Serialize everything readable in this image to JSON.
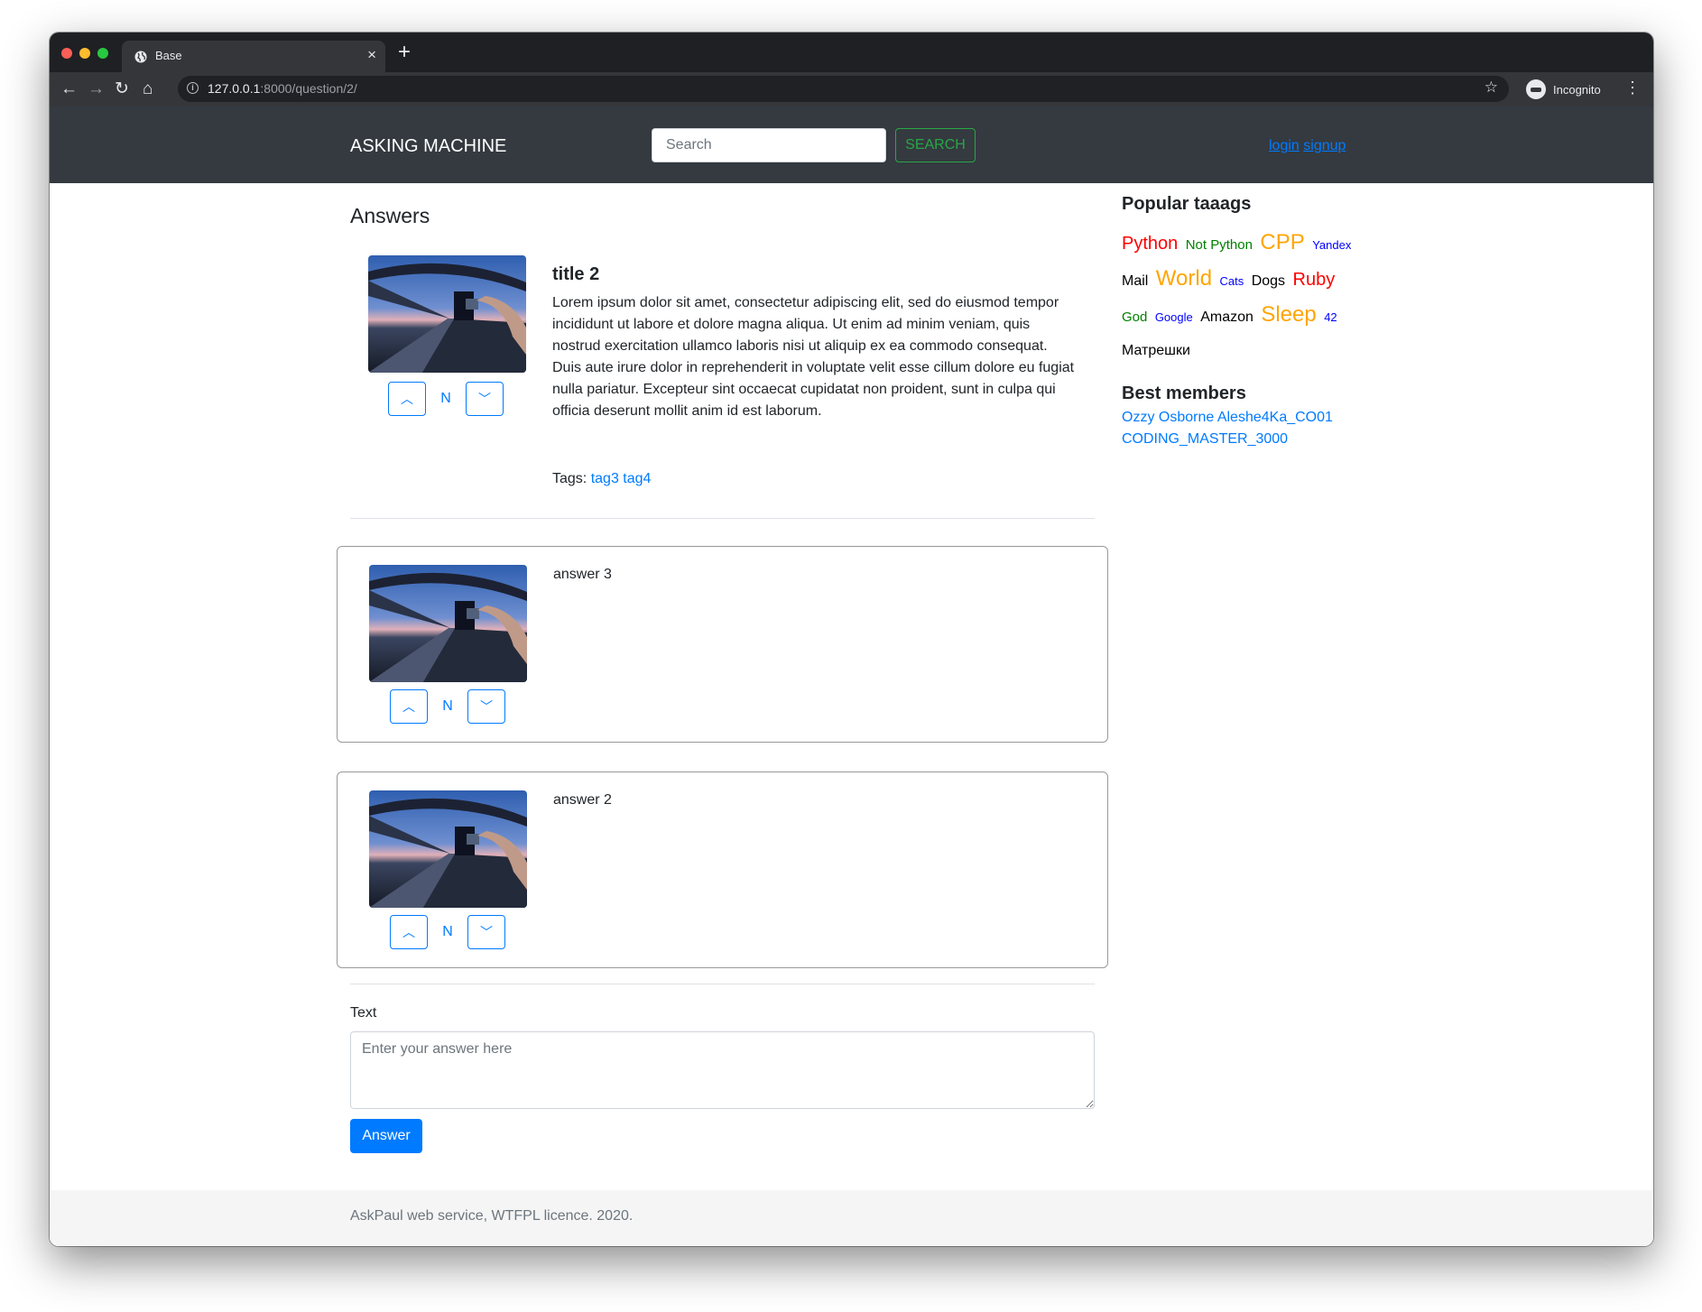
{
  "browser": {
    "tab_title": "Base",
    "url_host": "127.0.0.1",
    "url_path": ":8000/question/2/",
    "profile": "Incognito"
  },
  "navbar": {
    "brand": "ASKING MACHINE",
    "search_placeholder": "Search",
    "search_button": "SEARCH",
    "login": "login",
    "signup": "signup"
  },
  "main": {
    "heading": "Answers",
    "question": {
      "title": "title 2",
      "body": "Lorem ipsum dolor sit amet, consectetur adipiscing elit, sed do eiusmod tempor incididunt ut labore et dolore magna aliqua. Ut enim ad minim veniam, quis nostrud exercitation ullamco laboris nisi ut aliquip ex ea commodo consequat. Duis aute irure dolor in reprehenderit in voluptate velit esse cillum dolore eu fugiat nulla pariatur. Excepteur sint occaecat cupidatat non proident, sunt in culpa qui officia deserunt mollit anim id est laborum.",
      "tags_label": "Tags:",
      "tags": [
        "tag3",
        "tag4"
      ],
      "vote_up": "︿",
      "vote_count": "N",
      "vote_down": "﹀"
    },
    "answers": [
      {
        "text": "answer 3",
        "vote_up": "︿",
        "vote_count": "N",
        "vote_down": "﹀"
      },
      {
        "text": "answer 2",
        "vote_up": "︿",
        "vote_count": "N",
        "vote_down": "﹀"
      }
    ],
    "form": {
      "label": "Text",
      "placeholder": "Enter your answer here",
      "submit": "Answer"
    }
  },
  "sidebar": {
    "tags_heading": "Popular taaags",
    "tags": [
      {
        "name": "Python",
        "color": "#ff0000",
        "size": "large"
      },
      {
        "name": "Not Python",
        "color": "#008000",
        "size": "small"
      },
      {
        "name": "CPP",
        "color": "#ffa500",
        "size": "xlarge"
      },
      {
        "name": "Yandex",
        "color": "#0000ff",
        "size": "xsmall"
      },
      {
        "name": "Mail",
        "color": "#000000",
        "size": "medium"
      },
      {
        "name": "World",
        "color": "#ffa500",
        "size": "xlarge"
      },
      {
        "name": "Cats",
        "color": "#0000ff",
        "size": "xsmall"
      },
      {
        "name": "Dogs",
        "color": "#000000",
        "size": "medium"
      },
      {
        "name": "Ruby",
        "color": "#ff0000",
        "size": "large"
      },
      {
        "name": "God",
        "color": "#008000",
        "size": "small"
      },
      {
        "name": "Google",
        "color": "#0000ff",
        "size": "xsmall"
      },
      {
        "name": "Amazon",
        "color": "#000000",
        "size": "medium"
      },
      {
        "name": "Sleep",
        "color": "#ffa500",
        "size": "xlarge"
      },
      {
        "name": "42",
        "color": "#0000ff",
        "size": "xsmall"
      },
      {
        "name": "Матрешки",
        "color": "#000000",
        "size": "medium"
      }
    ],
    "members_heading": "Best members",
    "members": [
      "Ozzy Osborne",
      "Aleshe4Ka_CO01",
      "CODING_MASTER_3000"
    ]
  },
  "footer": {
    "text": "AskPaul web service, WTFPL licence. 2020."
  }
}
